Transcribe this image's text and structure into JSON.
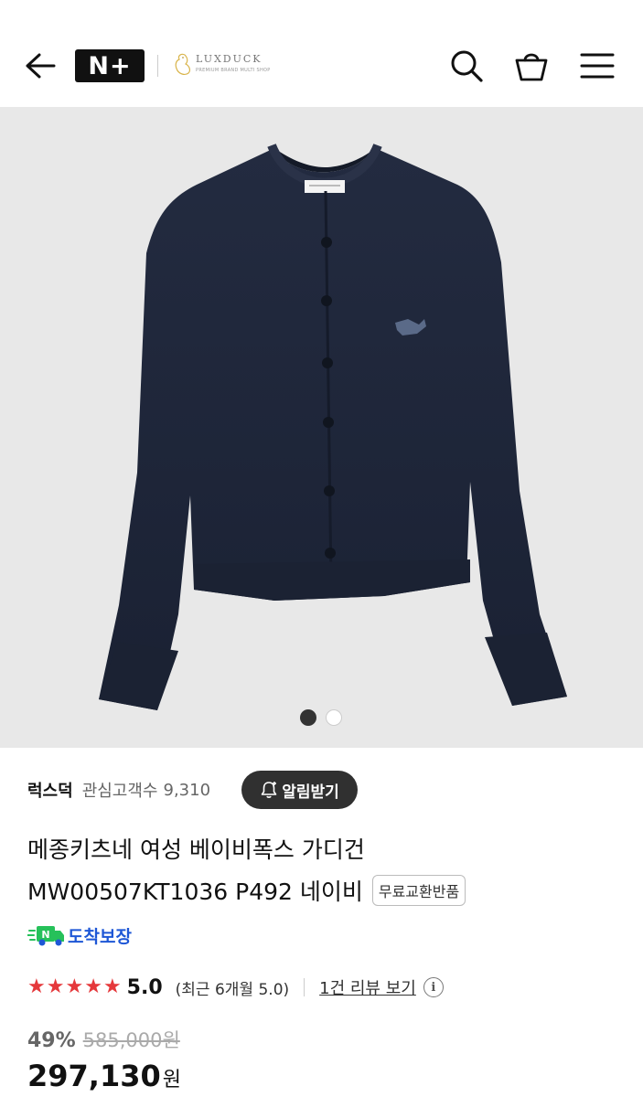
{
  "header": {
    "back_icon": "arrow-left-icon",
    "brand_logo_text": "N+",
    "partner_logo": {
      "name": "LUXDUCK",
      "tagline": "PREMIUM BRAND MULTI SHOP"
    },
    "search_icon": "search-icon",
    "bag_icon": "shopping-bag-icon",
    "menu_icon": "hamburger-menu-icon"
  },
  "gallery": {
    "total_images": 2,
    "active_index": 0,
    "background_color": "#e8e8e8",
    "product_color": "#1d2438"
  },
  "seller": {
    "name": "럭스덕",
    "watchers_label": "관심고객수",
    "watchers_count": "9,310",
    "alert_button": "알림받기",
    "alert_icon": "bell-plus-icon"
  },
  "product": {
    "title_line1": "메종키츠네 여성 베이비폭스 가디건",
    "title_line2": "MW00507KT1036 P492 네이비",
    "badge": "무료교환반품",
    "arrival_badge": "도착보장",
    "arrival_color": "#1e57d6"
  },
  "rating": {
    "stars": 5,
    "score": "5.0",
    "recent": "(최근 6개월 5.0)",
    "review_link": "1건 리뷰 보기",
    "star_color": "#e5383b"
  },
  "price": {
    "discount_rate": "49%",
    "original": "585,000원",
    "sale": "297,130",
    "currency": "원"
  }
}
